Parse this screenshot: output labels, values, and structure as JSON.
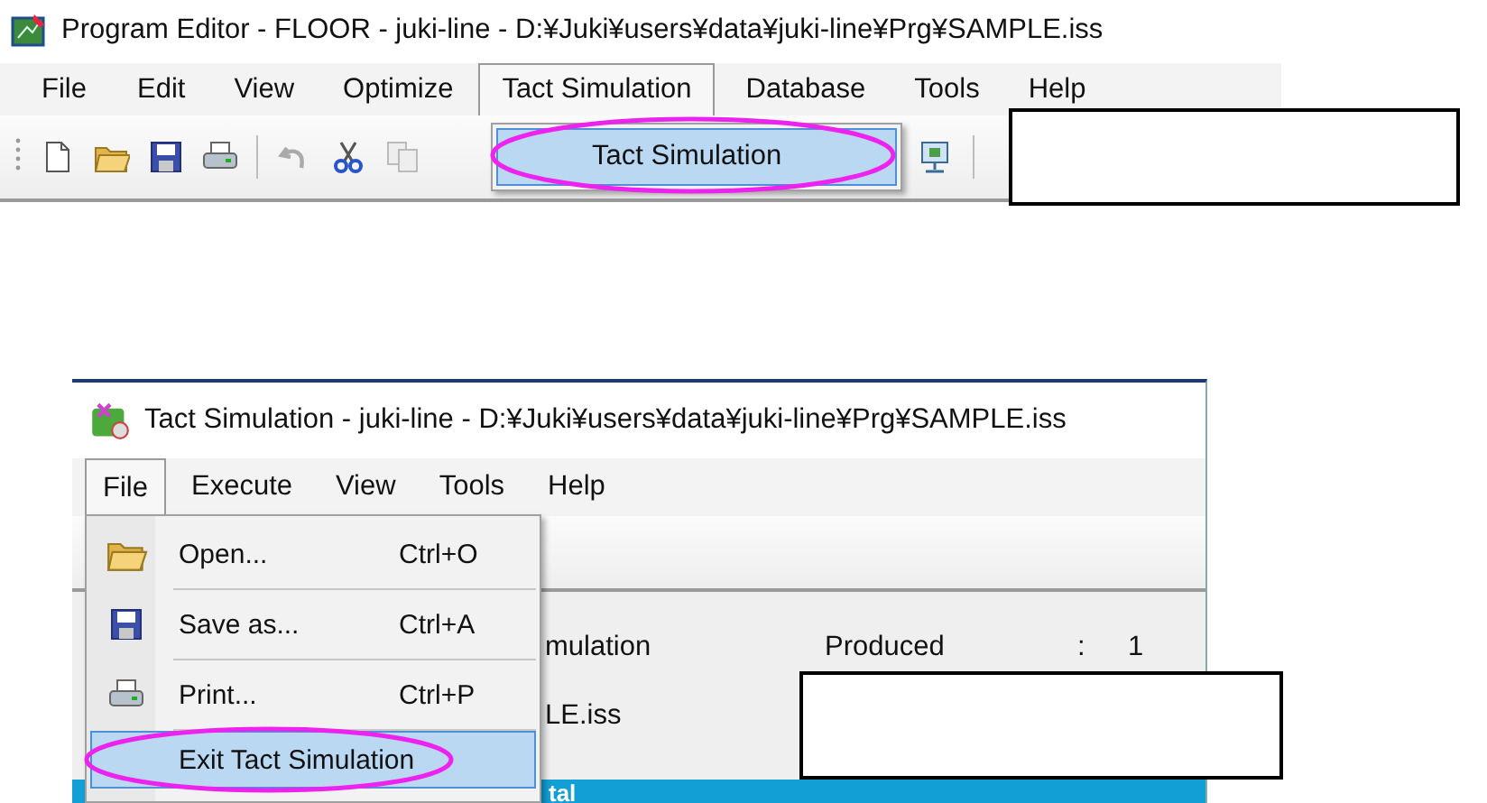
{
  "editor_window": {
    "title": "Program Editor - FLOOR - juki-line - D:¥Juki¥users¥data¥juki-line¥Prg¥SAMPLE.iss",
    "menu": [
      {
        "label": "File",
        "selected": false
      },
      {
        "label": "Edit",
        "selected": false
      },
      {
        "label": "View",
        "selected": false
      },
      {
        "label": "Optimize",
        "selected": false
      },
      {
        "label": "Tact Simulation",
        "selected": true
      },
      {
        "label": "Database",
        "selected": false
      },
      {
        "label": "Tools",
        "selected": false
      },
      {
        "label": "Help",
        "selected": false
      }
    ],
    "dropdown": [
      {
        "label": "Tact Simulation",
        "selected": true
      }
    ]
  },
  "simulation_window": {
    "title": "Tact Simulation - juki-line - D:¥Juki¥users¥data¥juki-line¥Prg¥SAMPLE.iss",
    "menu": [
      {
        "label": "File",
        "selected": true
      },
      {
        "label": "Execute",
        "selected": false
      },
      {
        "label": "View",
        "selected": false
      },
      {
        "label": "Tools",
        "selected": false
      },
      {
        "label": "Help",
        "selected": false
      }
    ],
    "dropdown": [
      {
        "kind": "open",
        "label": "Open...",
        "shortcut": "Ctrl+O",
        "selected": false
      },
      {
        "kind": "save",
        "label": "Save as...",
        "shortcut": "Ctrl+A",
        "selected": false
      },
      {
        "kind": "print",
        "label": "Print...",
        "shortcut": "Ctrl+P",
        "selected": false
      },
      {
        "kind": "exit",
        "label": "Exit Tact Simulation",
        "selected": true
      }
    ],
    "info": {
      "column_1": "mulation",
      "produced_label": "Produced",
      "separator": ":",
      "produced_value": "1",
      "file": "LE.iss"
    },
    "banner": "tal"
  }
}
